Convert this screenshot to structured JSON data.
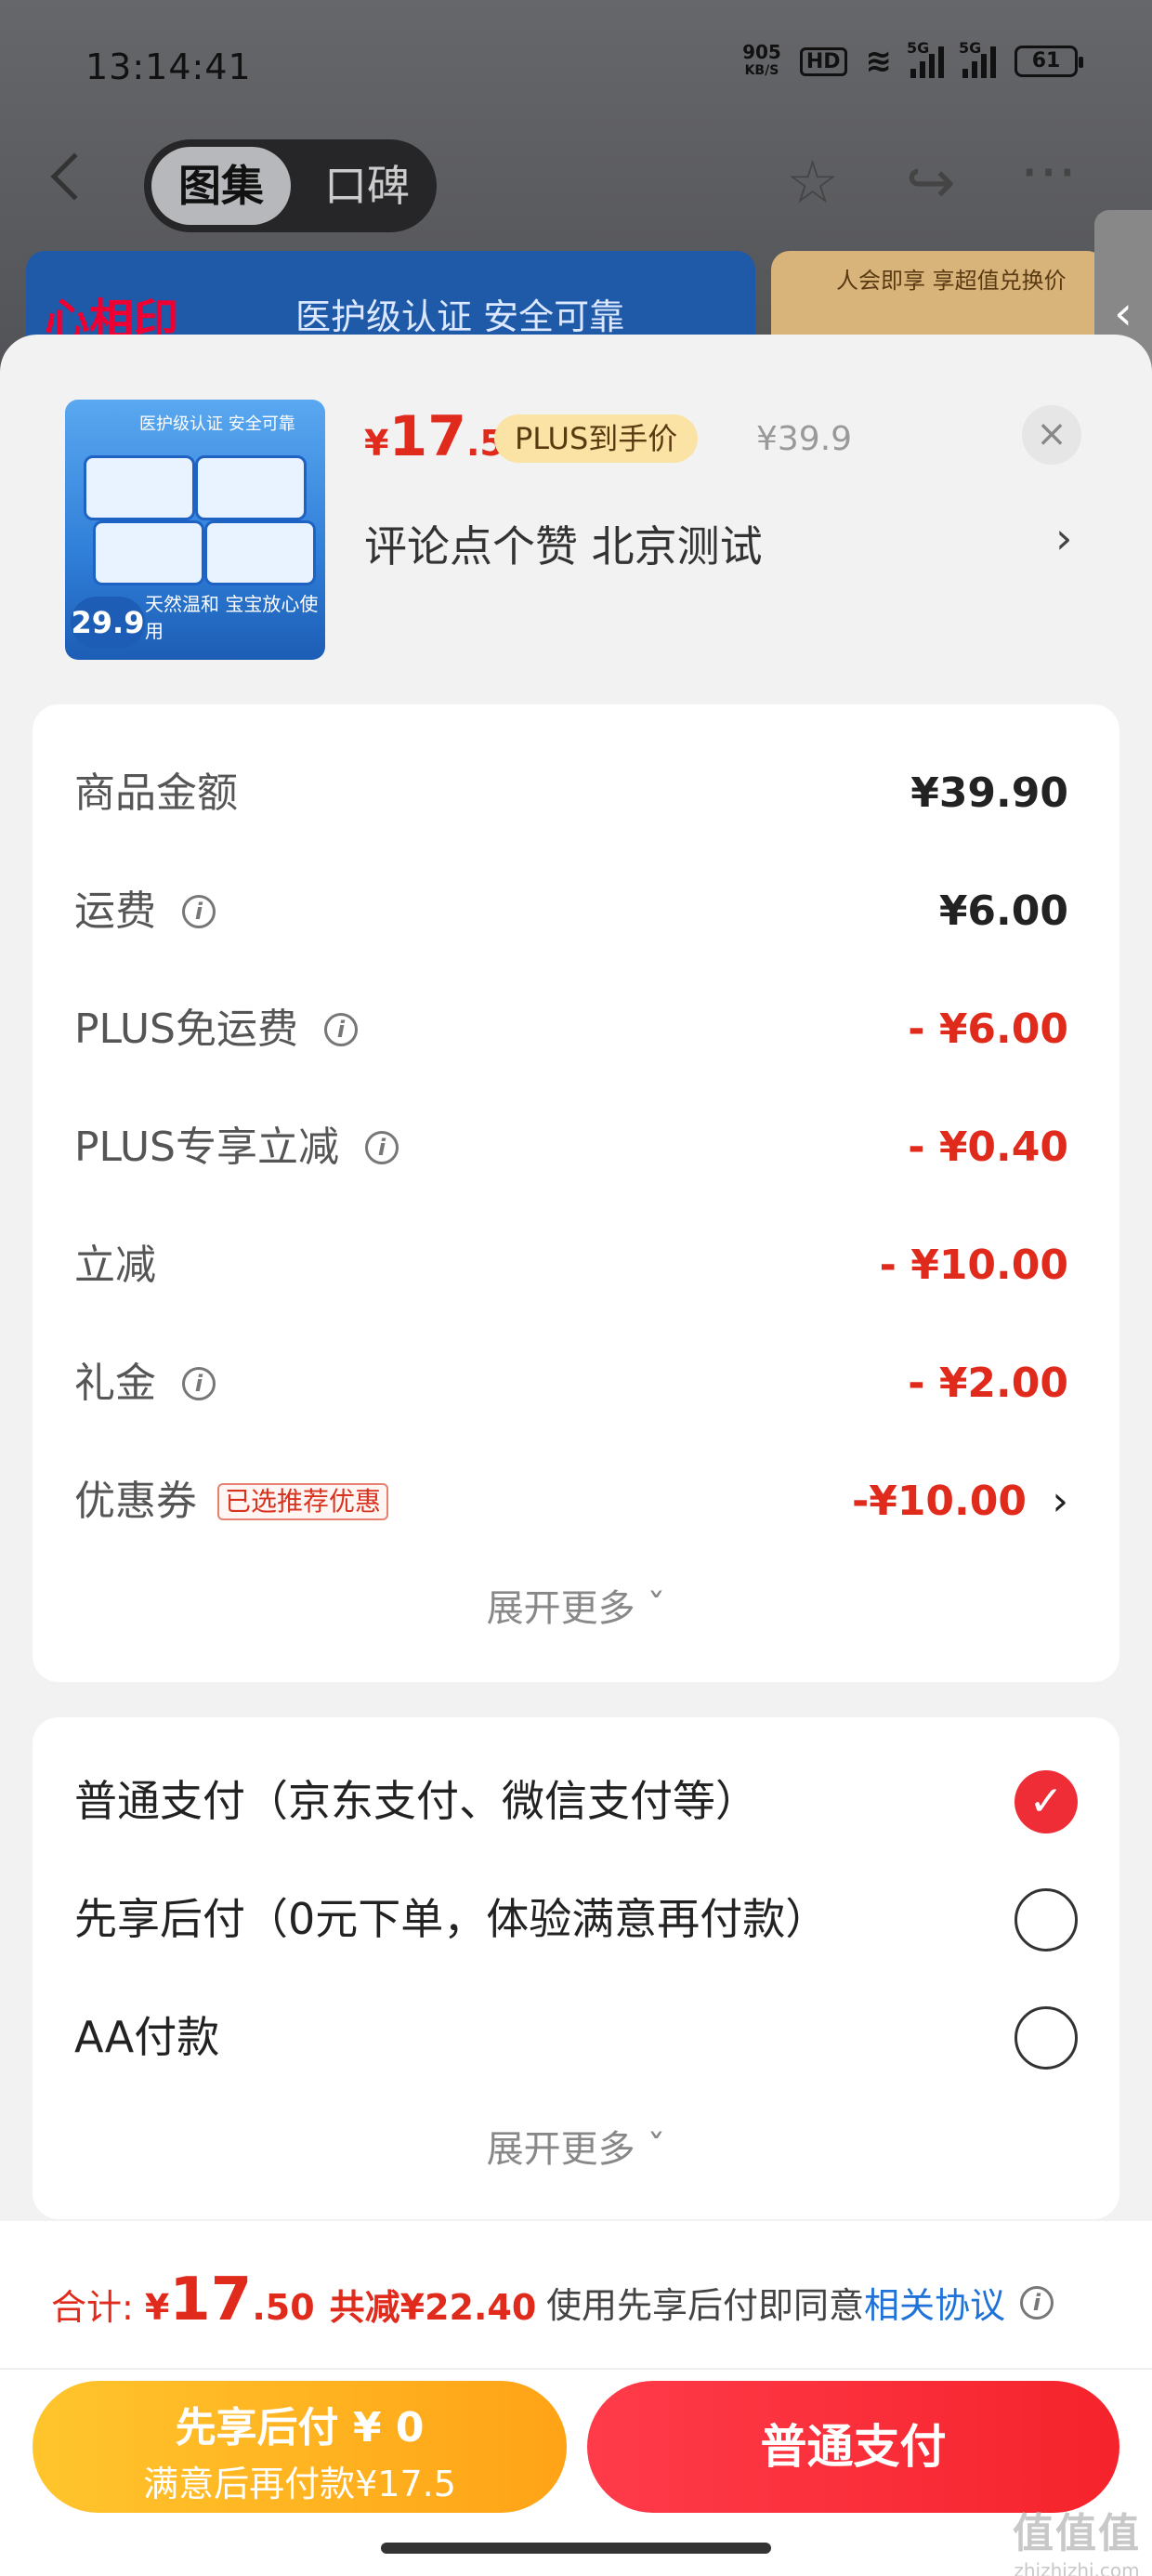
{
  "status_bar": {
    "time": "13:14:41",
    "net_speed": "905",
    "net_unit": "KB/S",
    "hd": "HD",
    "signal1": "5G",
    "signal2": "5G",
    "battery": "61"
  },
  "header": {
    "tab_gallery": "图集",
    "tab_reviews": "口碑",
    "back_icon": "back-arrow-icon",
    "star_icon": "star-icon",
    "share_icon": "share-icon",
    "more_icon": "more-icon"
  },
  "banner": {
    "logo": "心相印",
    "text": "医护级认证 安全可靠",
    "side_text": "人会即享 享超值兑换价"
  },
  "product": {
    "image_top_text": "医护级认证 安全可靠",
    "image_price": "29.9",
    "image_slogan": "天然温和 宝宝放心使用",
    "price_symbol": "¥",
    "price_int": "17",
    "price_dec": ".5",
    "plus_tag": "PLUS到手价",
    "original_price": "¥39.9",
    "title": "评论点个赞  北京测试",
    "close": "×",
    "arrow": "›"
  },
  "costs": {
    "rows": [
      {
        "label": "商品金额",
        "value": "¥39.90"
      },
      {
        "label": "运费",
        "value": "¥6.00"
      },
      {
        "label": "PLUS免运费",
        "value": "- ¥6.00"
      },
      {
        "label": "PLUS专享立减",
        "value": "- ¥0.40"
      },
      {
        "label": "立减",
        "value": "- ¥10.00"
      },
      {
        "label": "礼金",
        "value": "- ¥2.00"
      },
      {
        "label": "优惠券",
        "value": "-¥10.00",
        "tag": "已选推荐优惠"
      }
    ],
    "more": "展开更多 ˇ"
  },
  "payment": {
    "options": [
      {
        "label": "普通支付（京东支付、微信支付等）",
        "selected": true
      },
      {
        "label": "先享后付（0元下单，体验满意再付款）",
        "selected": false
      },
      {
        "label": "AA付款",
        "selected": false
      }
    ],
    "more": "展开更多 ˇ"
  },
  "footer": {
    "total_label": "合计:",
    "total_symbol": "¥",
    "total_int": "17",
    "total_dec": ".50",
    "saved": "共减¥22.40",
    "agree_text": "使用先享后付即同意",
    "agree_link": "相关协议",
    "btn_later_line1": "先享后付 ¥ 0",
    "btn_later_line2": "满意后再付款¥17.5",
    "btn_normal": "普通支付",
    "watermark": "值值值",
    "watermark_sub": "zhizhizhi.com"
  },
  "colors": {
    "accent_red": "#e02a1c",
    "pay_yellow": "#ffb320",
    "pay_red": "#f5232b",
    "link_blue": "#1f73d8"
  }
}
